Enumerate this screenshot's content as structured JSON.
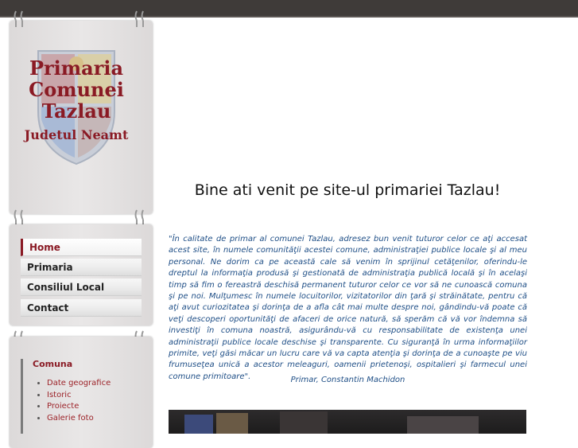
{
  "logo": {
    "line1": "Primaria",
    "line2": "Comunei",
    "line3": "Tazlau",
    "line4": "Judetul Neamt"
  },
  "nav": {
    "items": [
      {
        "label": "Home",
        "active": true
      },
      {
        "label": "Primaria",
        "active": false
      },
      {
        "label": "Consiliul Local",
        "active": false
      },
      {
        "label": "Contact",
        "active": false
      }
    ]
  },
  "submenu": {
    "title": "Comuna",
    "items": [
      "Date geografice",
      "Istoric",
      "Proiecte",
      "Galerie foto"
    ]
  },
  "main": {
    "welcome": "Bine ati venit pe site-ul primariei Tazlau!",
    "message": "\"În calitate de primar al comunei Tazlau, adresez bun venit tuturor celor ce aţi accesat acest site, în numele comunităţii acestei comune, administraţiei publice locale şi al meu personal. Ne dorim ca pe această cale să venim în sprijinul cetăţenilor, oferindu-le dreptul la informaţia produsă şi gestionată de administraţia publică locală şi în acelaşi timp să fim o fereastră deschisă permanent tuturor celor ce vor să ne cunoască comuna şi pe noi. Mulţumesc în numele locuitorilor, vizitatorilor din ţară şi străinătate, pentru că aţi avut curiozitatea şi dorinţa de a afla cât mai multe despre noi, gândindu-vă poate că veţi descoperi oportunităţi de afaceri de orice natură, să sperăm că vă vor îndemna să investiţi în comuna noastră, asigurându-vă cu responsabilitate de existenţa unei administraţii publice locale deschise şi transparente. Cu siguranţă în urma informaţiilor primite, veţi găsi măcar un lucru care vă va capta atenţia şi dorinţa de a cunoaşte pe viu frumuseţea unică a acestor meleaguri, oamenii prietenoşi, ospitalieri şi farmecul unei comune primitoare\".",
    "signature": "Primar, Constantin Machidon"
  },
  "colors": {
    "brand": "#8a1a24",
    "text_blue": "#1e4e86",
    "topbar": "#3f3b39"
  }
}
